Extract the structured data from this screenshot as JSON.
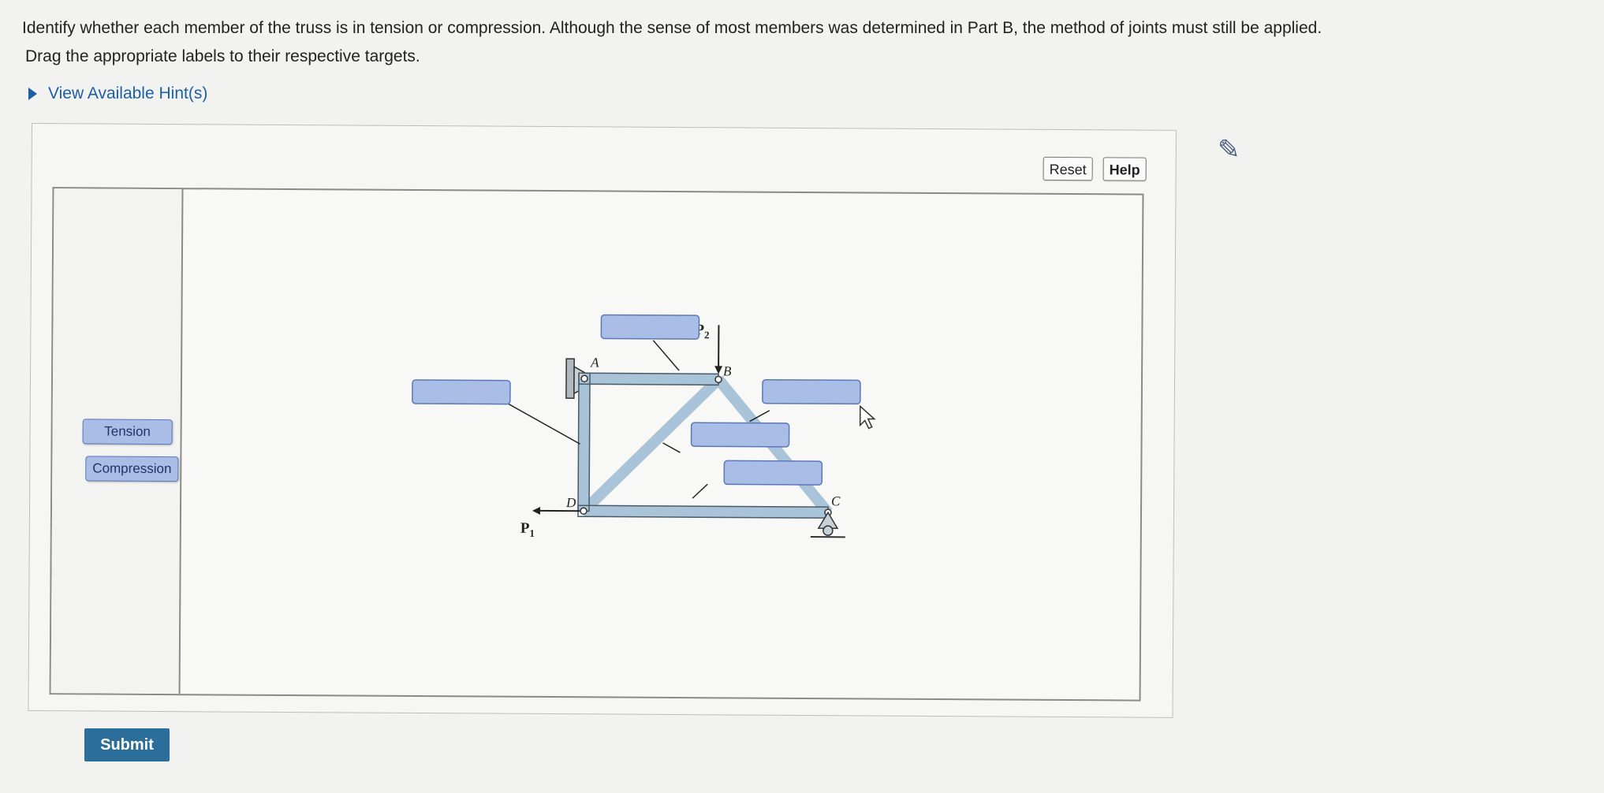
{
  "instructions": {
    "line1": "Identify whether each member of the truss is in tension or compression. Although the sense of most members was determined in Part B, the method of joints must still be applied.",
    "line2": "Drag the appropriate labels to their respective targets."
  },
  "hint": {
    "label": "View Available Hint(s)"
  },
  "toolbar": {
    "reset_label": "Reset",
    "help_label": "Help"
  },
  "labels": {
    "tension": "Tension",
    "compression": "Compression"
  },
  "diagram": {
    "joint_a": "A",
    "joint_b": "B",
    "joint_c": "C",
    "joint_d": "D",
    "load_p1": "P",
    "load_p1_sub": "1",
    "load_p2": "P",
    "load_p2_sub": "2"
  },
  "targets": [
    "",
    "",
    "",
    "",
    ""
  ],
  "submit": {
    "label": "Submit"
  },
  "colors": {
    "member": "#a9c3d8",
    "target": "#a9bde6",
    "submit": "#2b6e9b",
    "link": "#1d5fa6"
  }
}
